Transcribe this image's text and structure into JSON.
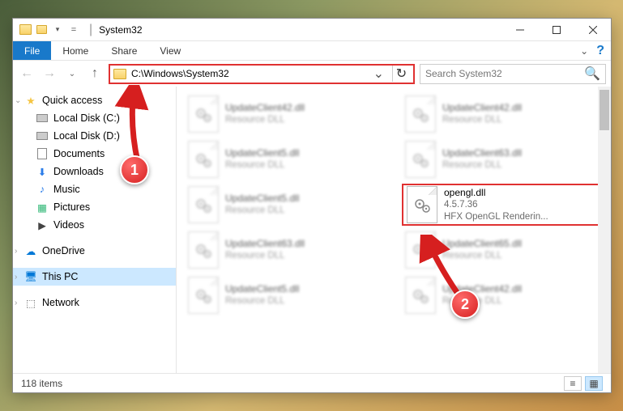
{
  "window": {
    "title": "System32"
  },
  "ribbon": {
    "file": "File",
    "home": "Home",
    "share": "Share",
    "view": "View"
  },
  "address": {
    "path": "C:\\Windows\\System32"
  },
  "search": {
    "placeholder": "Search System32"
  },
  "nav": {
    "quick": "Quick access",
    "items": [
      "Local Disk (C:)",
      "Local Disk (D:)",
      "Documents",
      "Downloads",
      "Music",
      "Pictures",
      "Videos"
    ],
    "onedrive": "OneDrive",
    "thispc": "This PC",
    "network": "Network"
  },
  "files": [
    {
      "name": "UpdateClient42.dll",
      "sub": "Resource DLL"
    },
    {
      "name": "UpdateClient42.dll",
      "sub": "Resource DLL"
    },
    {
      "name": "UpdateClient5.dll",
      "sub": "Resource DLL"
    },
    {
      "name": "UpdateClient63.dll",
      "sub": "Resource DLL"
    },
    {
      "name": "UpdateClient5.dll",
      "sub": "Resource DLL"
    },
    {
      "name": "opengl.dll",
      "sub1": "4.5.7.36",
      "sub2": "HFX OpenGL Renderin...",
      "highlight": true
    },
    {
      "name": "UpdateClient63.dll",
      "sub": "Resource DLL"
    },
    {
      "name": "UpdateClient65.dll",
      "sub": "Resource DLL"
    },
    {
      "name": "UpdateClient5.dll",
      "sub": "Resource DLL"
    },
    {
      "name": "UpdateClient42.dll",
      "sub": "Resource DLL"
    }
  ],
  "status": {
    "count": "118 items"
  },
  "callouts": {
    "one": "1",
    "two": "2"
  },
  "colors": {
    "highlight": "#e03131",
    "selection": "#cce8ff",
    "accent": "#1979ca"
  }
}
